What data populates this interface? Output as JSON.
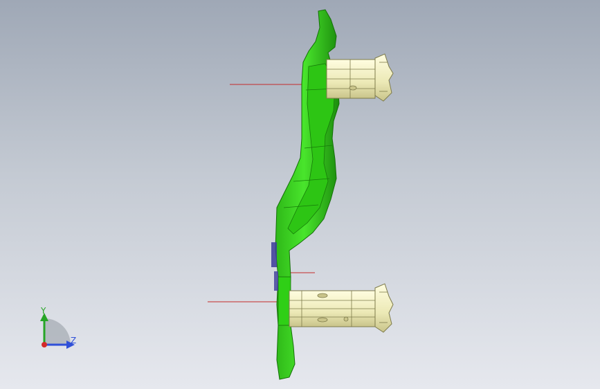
{
  "viewport": {
    "background_top": "#9fa8b6",
    "background_bottom": "#e6e8ee"
  },
  "model": {
    "part_color": "#3fdc1f",
    "part_shadow": "#1f9a10",
    "clamp_color": "#f1f0c8",
    "leader_color": "#c42a2a"
  },
  "triad": {
    "y_label": "Y",
    "z_label": "Z",
    "x_color": "#d42a2a",
    "y_color": "#26a526",
    "z_color": "#2f4fd8"
  }
}
